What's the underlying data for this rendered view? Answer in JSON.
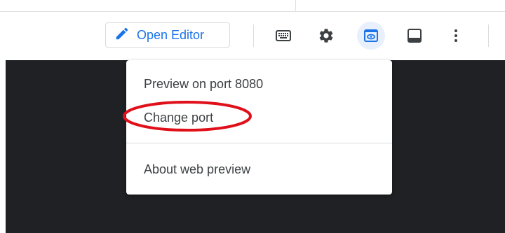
{
  "toolbar": {
    "open_editor_label": "Open Editor",
    "icons": [
      "keyboard-icon",
      "settings-icon",
      "web-preview-icon",
      "terminal-panel-icon",
      "more-vert-icon"
    ],
    "accent_color": "#1a73e8",
    "active_icon_bg": "#e8f0fe"
  },
  "menu": {
    "items": [
      {
        "label": "Preview on port 8080"
      },
      {
        "label": "Change port"
      },
      {
        "label": "About web preview"
      }
    ]
  },
  "annotation": {
    "highlight_color": "#e0101a",
    "highlighted_item": "Change port"
  },
  "terminal": {
    "background": "#202124"
  }
}
